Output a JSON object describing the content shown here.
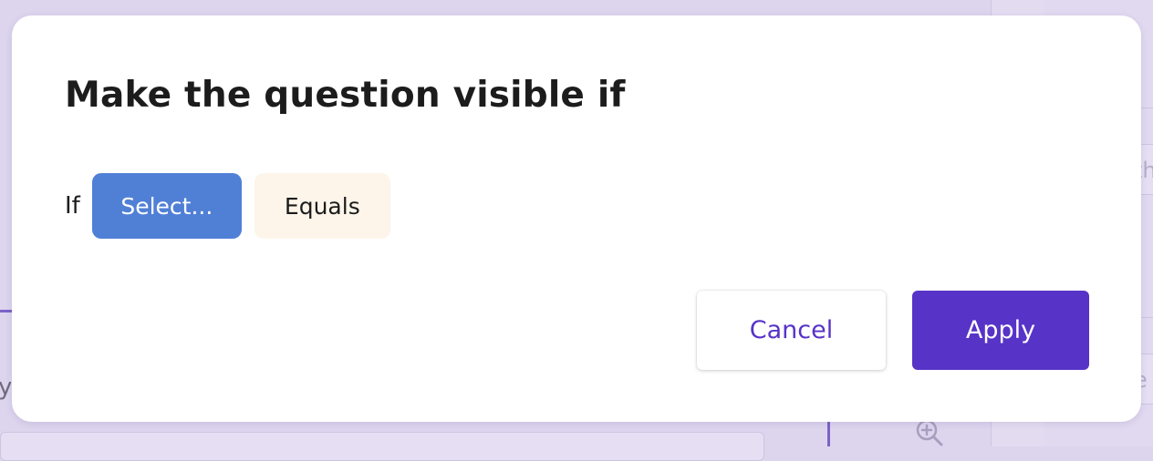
{
  "background": {
    "partial_left_text": "yo",
    "partial_right_field_1": "th",
    "partial_right_field_2": "e"
  },
  "modal": {
    "title": "Make the question visible if",
    "condition": {
      "if_label": "If",
      "field_select_label": "Select...",
      "operator_label": "Equals"
    },
    "buttons": {
      "cancel_label": "Cancel",
      "apply_label": "Apply"
    }
  },
  "colors": {
    "accent": "#5733c7",
    "select_chip": "#5080d6",
    "operator_chip": "#fdf5ea",
    "backdrop": "#ddd5ee"
  },
  "icons": {
    "background_zoom": "zoom-in-icon"
  }
}
